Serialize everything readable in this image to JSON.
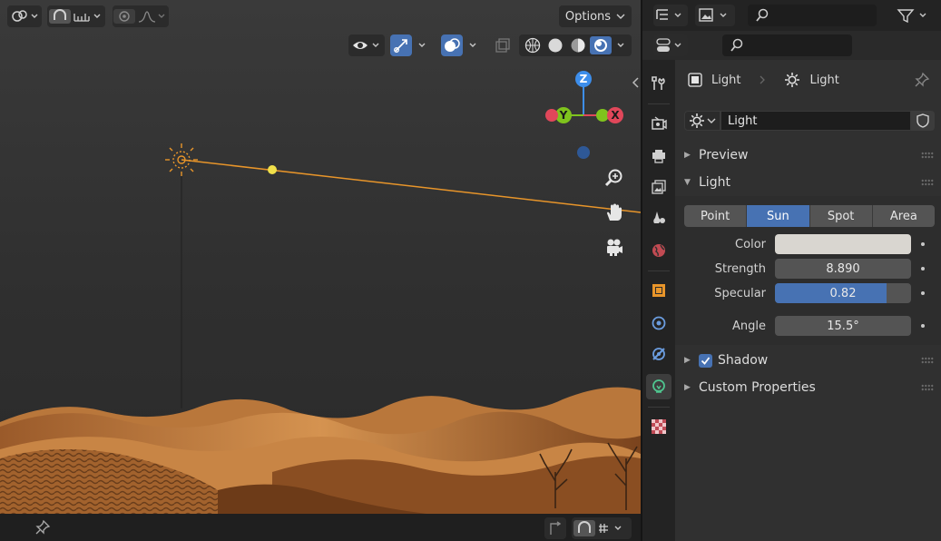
{
  "viewport": {
    "header": {
      "options_label": "Options"
    },
    "gizmo": {
      "z": "Z",
      "y": "Y",
      "x": "X"
    }
  },
  "properties": {
    "breadcrumb": {
      "object": "Light",
      "data": "Light"
    },
    "datablock": {
      "name": "Light"
    },
    "panels": {
      "preview": "Preview",
      "light": "Light",
      "shadow": "Shadow",
      "custom_properties": "Custom Properties"
    },
    "light_types": [
      "Point",
      "Sun",
      "Spot",
      "Area"
    ],
    "active_light_type": "Sun",
    "fields": {
      "color": {
        "label": "Color",
        "value": "#d9d6d0"
      },
      "strength": {
        "label": "Strength",
        "value": "8.890"
      },
      "specular": {
        "label": "Specular",
        "value": "0.82",
        "fraction": 0.82
      },
      "angle": {
        "label": "Angle",
        "value": "15.5°"
      }
    },
    "shadow_enabled": true
  },
  "colors": {
    "accent": "#4772b3",
    "light_line": "#e8952a",
    "axis_x": "#e0475a",
    "axis_y": "#7fc31d",
    "axis_z": "#3d8eeb"
  }
}
